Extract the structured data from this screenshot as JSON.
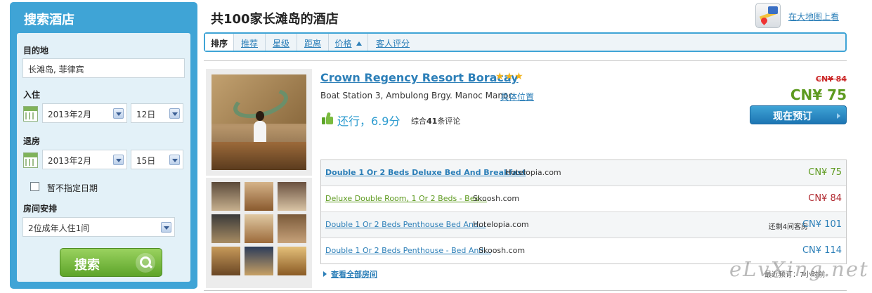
{
  "search": {
    "title": "搜索酒店",
    "destination_label": "目的地",
    "destination_value": "长滩岛, 菲律宾",
    "checkin_label": "入住",
    "checkin_month": "2013年2月",
    "checkin_day": "12日",
    "checkout_label": "退房",
    "checkout_month": "2013年2月",
    "checkout_day": "15日",
    "no_date_label": "暂不指定日期",
    "no_date_checked": false,
    "rooms_label": "房间安排",
    "rooms_value": "2位成年人住1间",
    "search_button": "搜索"
  },
  "header": {
    "title": "共100家长滩岛的酒店",
    "map_link": "在大地图上看"
  },
  "sort": {
    "label": "排序",
    "options": [
      "推荐",
      "星级",
      "距离",
      "价格",
      "客人评分"
    ]
  },
  "hotel": {
    "name": "Crown Regency Resort Boracay",
    "stars": "★★★",
    "star_count": 3,
    "address": "Boat Station 3, Ambulong Brgy. Manoc Manoc",
    "location_link": "具体位置",
    "rating_text": "还行，6.9分",
    "review_prefix": "综合",
    "review_count": "41",
    "review_suffix": "条评论",
    "old_price": "CN¥ 84",
    "price": "CN¥ 75",
    "book_button": "现在预订",
    "rooms": [
      {
        "name": "Double 1 Or 2 Beds Deluxe Bed And Breakfast",
        "site": "Hotelopia.com",
        "note": "",
        "price": "CN¥ 75"
      },
      {
        "name": "Deluxe Double Room, 1 Or 2 Beds - Bed...",
        "site": "Skoosh.com",
        "note": "",
        "price": "CN¥ 84"
      },
      {
        "name": "Double 1 Or 2 Beds Penthouse Bed And...",
        "site": "Hotelopia.com",
        "note": "还剩4间客房",
        "price": "CN¥ 101"
      },
      {
        "name": "Double 1 Or 2 Beds Penthouse - Bed And...",
        "site": "Skoosh.com",
        "note": "",
        "price": "CN¥ 114"
      }
    ],
    "all_rooms_link": "查看全部房间",
    "recent_text": "最近预订：7小时前"
  },
  "watermark": "eLvXing.net",
  "colors": {
    "accent_blue": "#3fa4d6",
    "link_blue": "#2c7fb8",
    "price_green": "#5d9a1f",
    "price_red": "#b0272e",
    "star_gold": "#f1b31c"
  }
}
